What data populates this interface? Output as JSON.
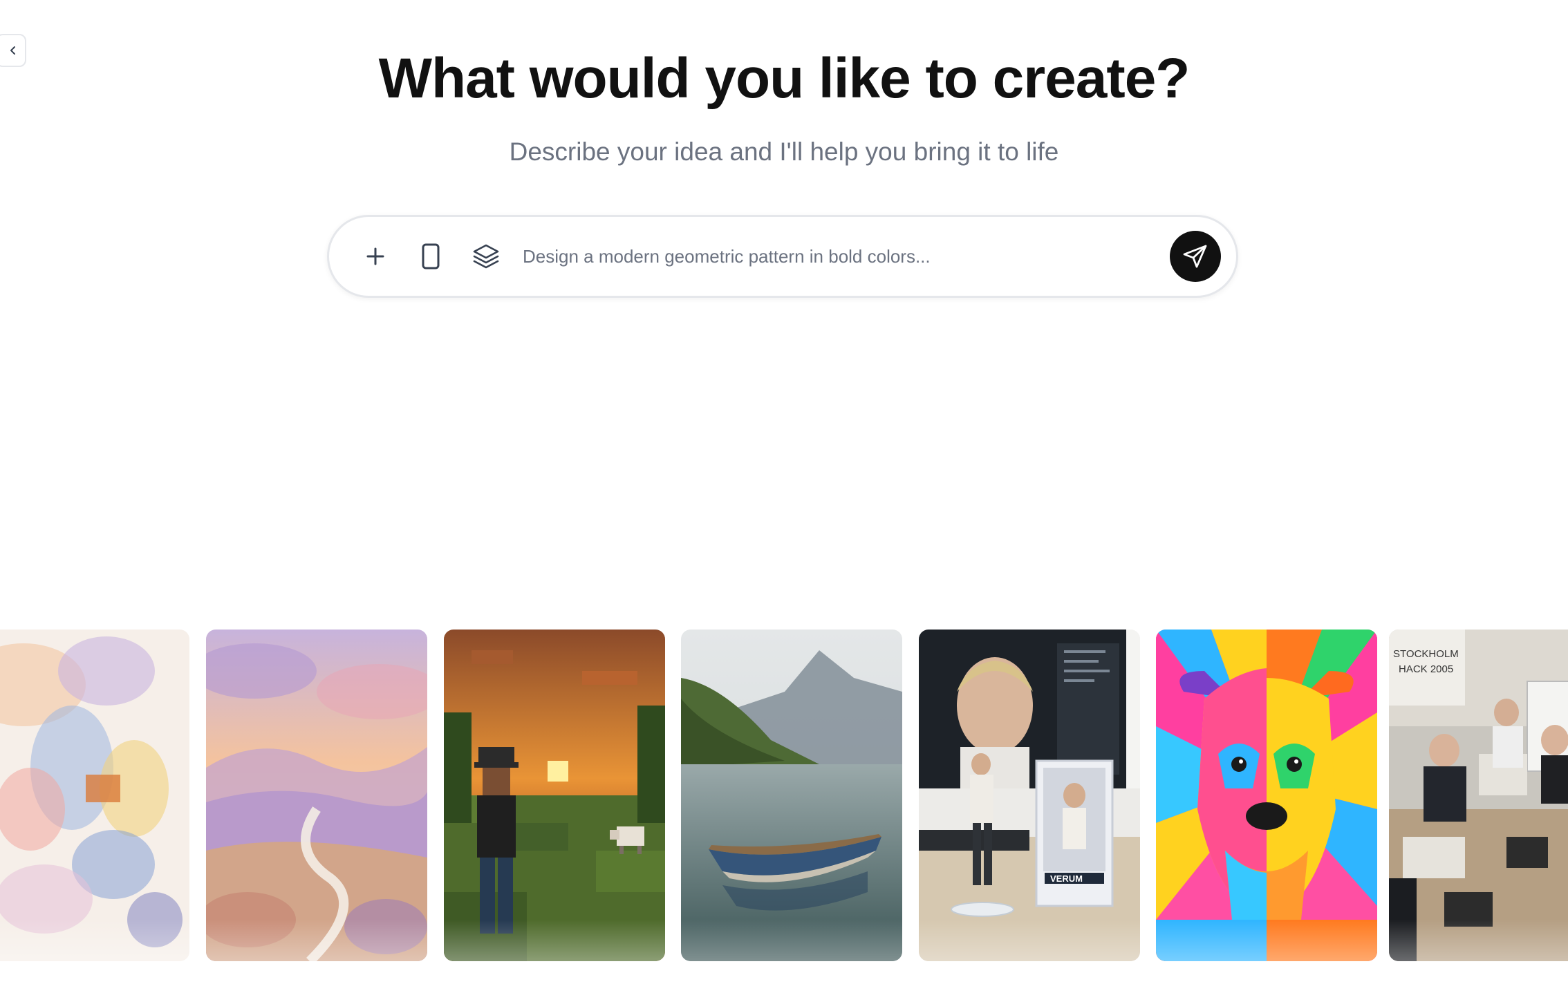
{
  "header": {
    "title": "What would you like to create?",
    "subtitle": "Describe your idea and I'll help you bring it to life"
  },
  "sidebar_toggle": {
    "icon": "chevron-left-icon"
  },
  "prompt_bar": {
    "placeholder": "Design a modern geometric pattern in bold colors...",
    "value": "",
    "icons": [
      "plus-icon",
      "phone-frame-icon",
      "layers-icon"
    ],
    "send_icon": "send-icon"
  },
  "gallery": {
    "items": [
      {
        "subject": "abstract watercolor splash"
      },
      {
        "subject": "watercolor valley landscape with river"
      },
      {
        "subject": "blocky pixel-art man watching sunset with sheep"
      },
      {
        "subject": "wooden rowboat on calm mountain lake"
      },
      {
        "subject": "action figure of a man in front of a 3D model on monitor",
        "box_text": "VERUM"
      },
      {
        "subject": "pop-art rainbow terrier dog portrait"
      },
      {
        "subject": "people at computers in a hackathon room",
        "banner_text": "STOCKHOLM HACK 2005"
      }
    ]
  }
}
